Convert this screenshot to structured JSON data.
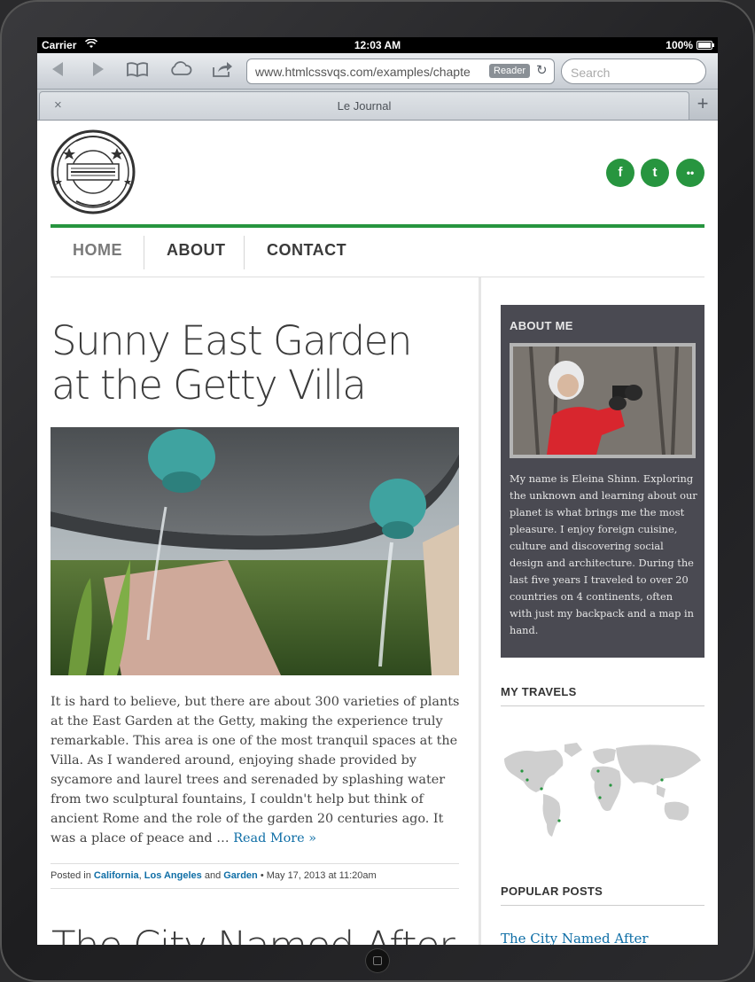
{
  "status_bar": {
    "carrier": "Carrier",
    "time": "12:03 AM",
    "battery": "100%"
  },
  "browser": {
    "url": "www.htmlcssvqs.com/examples/chapte",
    "reader_label": "Reader",
    "search_placeholder": "Search",
    "tab_title": "Le Journal",
    "tab_close": "×",
    "new_tab": "+"
  },
  "site": {
    "logo_text": "LE JOURNAL",
    "social": [
      {
        "icon": "facebook-icon",
        "glyph": "f"
      },
      {
        "icon": "twitter-icon",
        "glyph": "t"
      },
      {
        "icon": "flickr-icon",
        "glyph": "••"
      }
    ],
    "nav": [
      "HOME",
      "ABOUT",
      "CONTACT"
    ]
  },
  "post": {
    "title": "Sunny East Garden at the Getty Villa",
    "body": "It is hard to believe, but there are about 300 varieties of plants at the East Garden at the Getty, making the experience truly remarkable. This area is one of the most tranquil spaces at the Villa. As I wandered around, enjoying shade provided by sycamore and laurel trees and serenaded by splashing water from two sculptural fountains, I couldn't help but think of ancient Rome and the role of the garden 20 centuries ago. It was a place of peace and … ",
    "read_more": "Read More »",
    "meta": {
      "posted_in": "Posted in ",
      "cat1": "California",
      "sep1": ", ",
      "cat2": "Los Angeles",
      "and": " and ",
      "cat3": "Garden",
      "date": " • May 17, 2013 at 11:20am"
    },
    "next_title": "The City Named After"
  },
  "sidebar": {
    "about_heading": "ABOUT ME",
    "about_text": "My name is Eleina Shinn. Exploring the unknown and learning about our planet is what brings me the most pleasure. I enjoy foreign cuisine, culture and discovering social design and architecture. During the last five years I traveled to over 20 countries on 4 continents, often with just my backpack and a map in hand.",
    "travels_heading": "MY TRAVELS",
    "popular_heading": "POPULAR POSTS",
    "popular_link": "The City Named After"
  },
  "colors": {
    "accent": "#27953f",
    "link": "#0f6ea6",
    "about_bg": "#4a4a52"
  }
}
